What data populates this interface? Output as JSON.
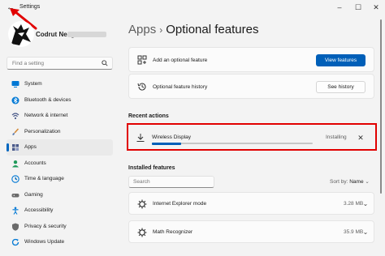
{
  "window": {
    "title": "Settings",
    "back_icon": "back-arrow-icon",
    "minimize": "–",
    "maximize": "☐",
    "close": "✕"
  },
  "user": {
    "name": "Codrut Neagu"
  },
  "search": {
    "placeholder": "Find a setting"
  },
  "sidebar": {
    "items": [
      {
        "label": "System",
        "icon": "monitor-icon",
        "color": "#0078d4"
      },
      {
        "label": "Bluetooth & devices",
        "icon": "bluetooth-icon",
        "color": "#0078d4"
      },
      {
        "label": "Network & internet",
        "icon": "wifi-icon",
        "color": "#4a5a8a"
      },
      {
        "label": "Personalization",
        "icon": "brush-icon",
        "color": "#d18a3a"
      },
      {
        "label": "Apps",
        "icon": "apps-icon",
        "color": "#4a5a8a",
        "active": true
      },
      {
        "label": "Accounts",
        "icon": "person-icon",
        "color": "#1f9a5a"
      },
      {
        "label": "Time & language",
        "icon": "globe-clock-icon",
        "color": "#0078d4"
      },
      {
        "label": "Gaming",
        "icon": "controller-icon",
        "color": "#6b6b6b"
      },
      {
        "label": "Accessibility",
        "icon": "accessibility-icon",
        "color": "#0078d4"
      },
      {
        "label": "Privacy & security",
        "icon": "shield-icon",
        "color": "#6b6b6b"
      },
      {
        "label": "Windows Update",
        "icon": "update-icon",
        "color": "#0078d4"
      }
    ]
  },
  "breadcrumb": {
    "parent": "Apps",
    "separator": "›",
    "current": "Optional features"
  },
  "add_feature": {
    "label": "Add an optional feature",
    "button": "View features"
  },
  "history": {
    "label": "Optional feature history",
    "button": "See history"
  },
  "recent": {
    "title": "Recent actions",
    "feature": "Wireless Display",
    "status": "Installing",
    "progress": 0.18,
    "dismiss": "✕"
  },
  "installed": {
    "title": "Installed features",
    "search_placeholder": "Search",
    "sort_label": "Sort by:",
    "sort_value": "Name",
    "items": [
      {
        "name": "Internet Explorer mode",
        "size": "3.28 MB"
      },
      {
        "name": "Math Recognizer",
        "size": "35.9 MB"
      }
    ]
  },
  "colors": {
    "accent": "#005fb8",
    "highlight": "#e10000",
    "arrow": "#e10000"
  }
}
